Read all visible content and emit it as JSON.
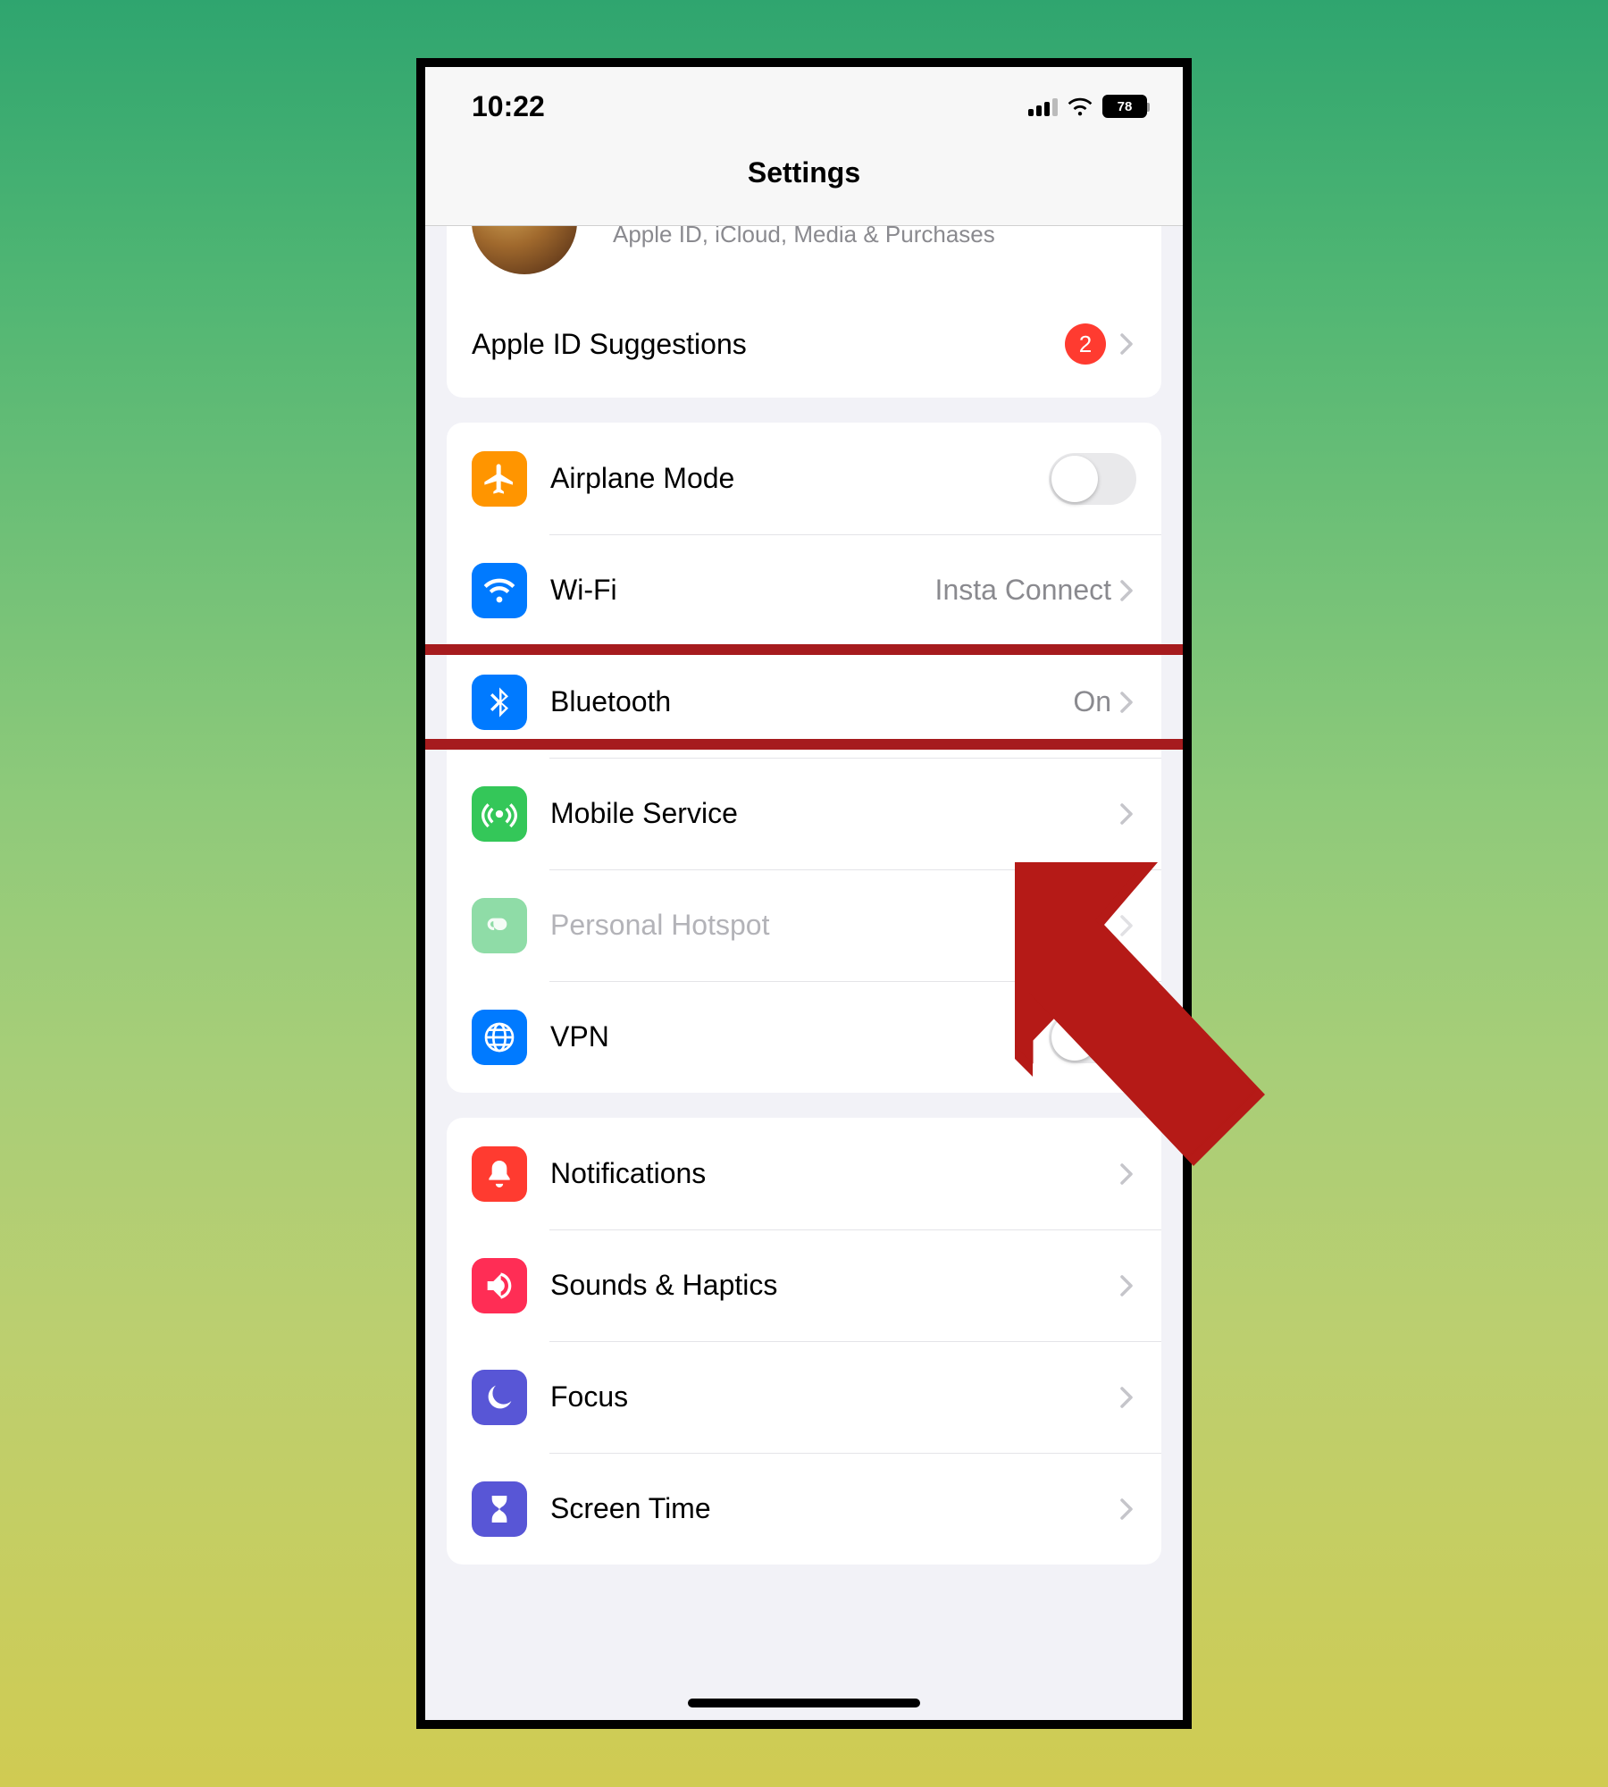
{
  "status": {
    "time": "10:22",
    "battery": "78"
  },
  "header": {
    "title": "Settings"
  },
  "apple_id": {
    "subtitle": "Apple ID, iCloud, Media & Purchases",
    "suggestions_label": "Apple ID Suggestions",
    "suggestions_badge": "2"
  },
  "connectivity": {
    "airplane": "Airplane Mode",
    "wifi": "Wi-Fi",
    "wifi_value": "Insta Connect",
    "bluetooth": "Bluetooth",
    "bluetooth_value": "On",
    "mobile": "Mobile Service",
    "hotspot": "Personal Hotspot",
    "vpn": "VPN"
  },
  "system": {
    "notifications": "Notifications",
    "sounds": "Sounds & Haptics",
    "focus": "Focus",
    "screentime": "Screen Time"
  },
  "colors": {
    "orange": "#ff9500",
    "blue": "#007aff",
    "green": "#34c759",
    "green_dim": "#8fdca7",
    "red": "#ff3b30",
    "pink": "#ff2d55",
    "indigo": "#5856d6",
    "highlight": "#a61b1e"
  }
}
